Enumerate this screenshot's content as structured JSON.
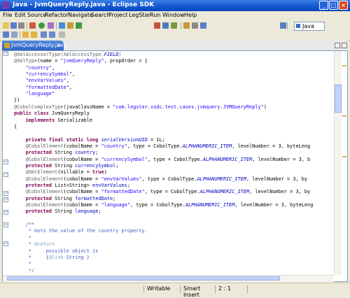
{
  "window": {
    "title": "Java - JvmQueryReply.java - Eclipse SDK"
  },
  "menu": [
    "File",
    "Edit",
    "Source",
    "Refactor",
    "Navigate",
    "Search",
    "Project",
    "LegStar",
    "Run",
    "Window",
    "Help"
  ],
  "perspective": {
    "label": "Java"
  },
  "editor": {
    "tab_label": "JvmQueryReply.java",
    "tab_close": "×",
    "lines": [
      [
        [
          "ann",
          "@XmlAccessorType(XmlAccessType."
        ],
        [
          "fld",
          "FIELD"
        ],
        [
          "ann",
          ")"
        ]
      ],
      [
        [
          "ann",
          "@XmlType"
        ],
        [
          "",
          "(name = "
        ],
        [
          "str",
          "\"jvmQueryReply\""
        ],
        [
          "",
          ", propOrder = {"
        ]
      ],
      [
        [
          "",
          "    "
        ],
        [
          "str",
          "\"country\""
        ],
        [
          "",
          ","
        ]
      ],
      [
        [
          "",
          "    "
        ],
        [
          "str",
          "\"currencySymbol\""
        ],
        [
          "",
          ","
        ]
      ],
      [
        [
          "",
          "    "
        ],
        [
          "str",
          "\"envVarValues\""
        ],
        [
          "",
          ","
        ]
      ],
      [
        [
          "",
          "    "
        ],
        [
          "str",
          "\"formattedDate\""
        ],
        [
          "",
          ","
        ]
      ],
      [
        [
          "",
          "    "
        ],
        [
          "str",
          "\"language\""
        ]
      ],
      [
        [
          "",
          "})"
        ]
      ],
      [
        [
          "ann",
          "@CobolComplexType"
        ],
        [
          "",
          "(javaClassName = "
        ],
        [
          "str",
          "\"com.legstar.xsdc.test.cases.jvmquery.JVMQueryReply\""
        ],
        [
          "",
          ")"
        ]
      ],
      [
        [
          "kw",
          "public class"
        ],
        [
          "",
          " JvmQueryReply"
        ]
      ],
      [
        [
          "",
          "    "
        ],
        [
          "kw",
          "implements"
        ],
        [
          "",
          " Serializable"
        ]
      ],
      [
        [
          "",
          "{"
        ]
      ],
      [
        [
          "",
          ""
        ]
      ],
      [
        [
          "",
          "    "
        ],
        [
          "kw",
          "private final static long"
        ],
        [
          "",
          ""
        ],
        [
          "fld",
          " serialVersionUID"
        ],
        [
          "",
          " = 1L;"
        ]
      ],
      [
        [
          "",
          "    "
        ],
        [
          "ann",
          "@CobolElement"
        ],
        [
          "",
          "(cobolName = "
        ],
        [
          "str",
          "\"country\""
        ],
        [
          "",
          ", type = CobolType."
        ],
        [
          "fld",
          "ALPHANUMERIC_ITEM"
        ],
        [
          "",
          ", levelNumber = 3, byteLeng"
        ]
      ],
      [
        [
          "",
          "    "
        ],
        [
          "kw",
          "protected"
        ],
        [
          "",
          " String "
        ],
        [
          "fld2",
          "country"
        ],
        [
          "",
          ";"
        ]
      ],
      [
        [
          "",
          "    "
        ],
        [
          "ann",
          "@CobolElement"
        ],
        [
          "",
          "(cobolName = "
        ],
        [
          "str",
          "\"currencySymbol\""
        ],
        [
          "",
          ", type = CobolType."
        ],
        [
          "fld",
          "ALPHANUMERIC_ITEM"
        ],
        [
          "",
          ", levelNumber = 3, b"
        ]
      ],
      [
        [
          "",
          "    "
        ],
        [
          "kw",
          "protected"
        ],
        [
          "",
          " String "
        ],
        [
          "fld2",
          "currencySymbol"
        ],
        [
          "",
          ";"
        ]
      ],
      [
        [
          "",
          "    "
        ],
        [
          "ann",
          "@XmlElement"
        ],
        [
          "",
          "(nillable = "
        ],
        [
          "kw",
          "true"
        ],
        [
          "",
          ")"
        ]
      ],
      [
        [
          "",
          "    "
        ],
        [
          "ann",
          "@CobolElement"
        ],
        [
          "",
          "(cobolName = "
        ],
        [
          "str",
          "\"envVarValues\""
        ],
        [
          "",
          ", type = CobolType."
        ],
        [
          "fld",
          "ALPHANUMERIC_ITEM"
        ],
        [
          "",
          ", levelNumber = 3, by"
        ]
      ],
      [
        [
          "",
          "    "
        ],
        [
          "kw",
          "protected"
        ],
        [
          "",
          " List<String> "
        ],
        [
          "fld2",
          "envVarValues"
        ],
        [
          "",
          ";"
        ]
      ],
      [
        [
          "",
          "    "
        ],
        [
          "ann",
          "@CobolElement"
        ],
        [
          "",
          "(cobolName = "
        ],
        [
          "str",
          "\"formattedDate\""
        ],
        [
          "",
          ", type = CobolType."
        ],
        [
          "fld",
          "ALPHANUMERIC_ITEM"
        ],
        [
          "",
          ", levelNumber = 3, by"
        ]
      ],
      [
        [
          "",
          "    "
        ],
        [
          "kw",
          "protected"
        ],
        [
          "",
          " String "
        ],
        [
          "fld2",
          "formattedDate"
        ],
        [
          "",
          ";"
        ]
      ],
      [
        [
          "",
          "    "
        ],
        [
          "ann",
          "@CobolElement"
        ],
        [
          "",
          "(cobolName = "
        ],
        [
          "str",
          "\"language\""
        ],
        [
          "",
          ", type = CobolType."
        ],
        [
          "fld",
          "ALPHANUMERIC_ITEM"
        ],
        [
          "",
          ", levelNumber = 3, byteLeng"
        ]
      ],
      [
        [
          "",
          "    "
        ],
        [
          "kw",
          "protected"
        ],
        [
          "",
          " String "
        ],
        [
          "fld2",
          "language"
        ],
        [
          "",
          ";"
        ]
      ],
      [
        [
          "",
          ""
        ]
      ],
      [
        [
          "",
          "    "
        ],
        [
          "cmt",
          "/**"
        ]
      ],
      [
        [
          "",
          "     "
        ],
        [
          "cmt",
          "* Gets the value of the country property."
        ]
      ],
      [
        [
          "",
          "     "
        ],
        [
          "cmt",
          "*"
        ]
      ],
      [
        [
          "",
          "     "
        ],
        [
          "cmt",
          "* "
        ],
        [
          "cmtk",
          "@return"
        ]
      ],
      [
        [
          "",
          "     "
        ],
        [
          "cmt",
          "*     possible object is"
        ]
      ],
      [
        [
          "",
          "     "
        ],
        [
          "cmt",
          "*     {"
        ],
        [
          "cmtk",
          "@link"
        ],
        [
          "cmt",
          " String }"
        ]
      ],
      [
        [
          "",
          "     "
        ],
        [
          "cmt",
          "*"
        ]
      ],
      [
        [
          "",
          "     "
        ],
        [
          "cmt",
          "*/"
        ]
      ]
    ]
  },
  "status": {
    "writable": "Writable",
    "insert_mode": "Smart Insert",
    "position": "2 : 1"
  }
}
